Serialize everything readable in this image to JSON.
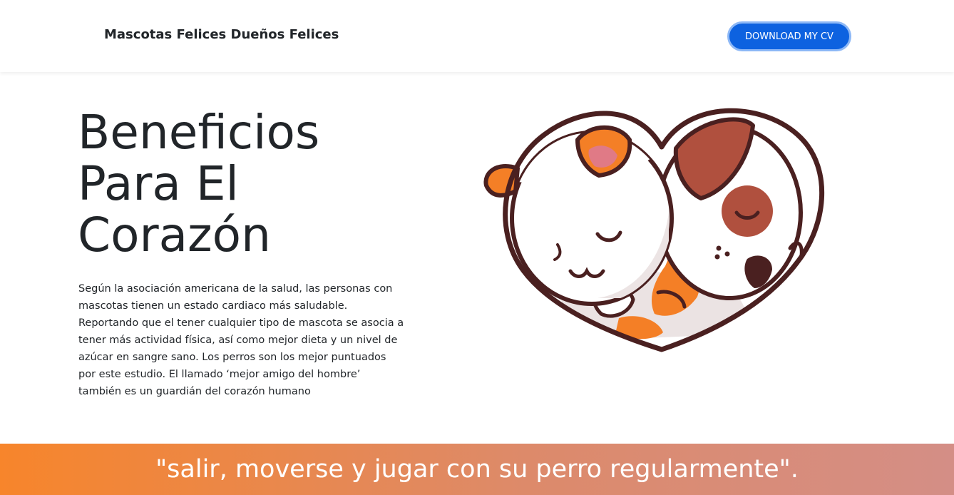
{
  "navbar": {
    "brand": "Mascotas Felices Dueños Felices",
    "cv_button": "DOWNLOAD MY CV"
  },
  "hero": {
    "title": "Beneficios Para El Corazón",
    "body": "Según la asociación americana de la salud, las personas con mascotas tienen un estado cardiaco más saludable. Reportando que el tener cualquier tipo de mascota se asocia a tener más actividad física, así como mejor dieta y un nivel de azúcar en sangre sano. Los perros son los mejor puntuados por este estudio. El llamado ‘mejor amigo del hombre’ también es un guardián del corazón humano",
    "illustration": "heart-shaped-cat-and-dog-illustration"
  },
  "quote": {
    "text": "\"salir, moverse y jugar con su perro regularmente\"."
  },
  "colors": {
    "button": "#0d62e0",
    "button_ring": "#8db8f6",
    "band_start": "#f7852b",
    "band_end": "#d48e86",
    "outline": "#4a2020",
    "orange": "#f47f26",
    "brown": "#b0503e"
  }
}
